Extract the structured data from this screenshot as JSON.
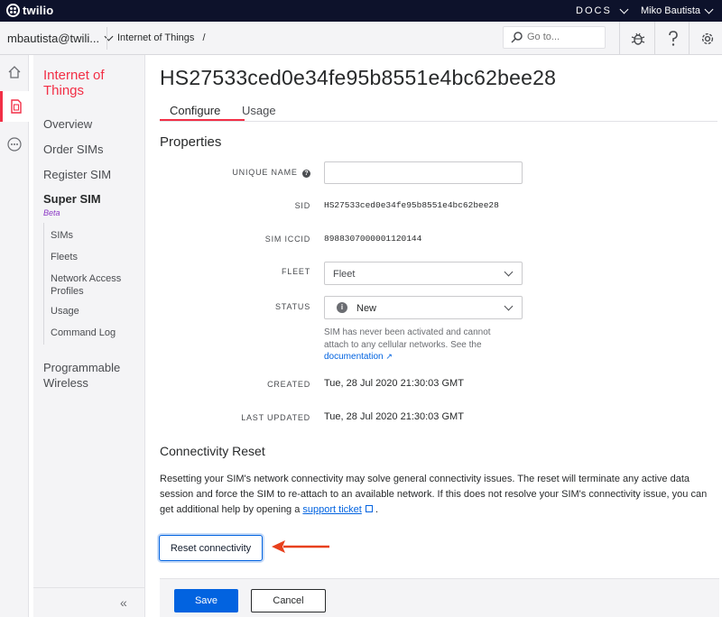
{
  "topbar": {
    "logo_text": "twilio",
    "docs_label": "DOCS",
    "user_name": "Miko Bautista"
  },
  "subbar": {
    "account": "mbautista@twili...",
    "breadcrumb": "Internet of Things",
    "breadcrumb_sep": "/",
    "search_placeholder": "Go to..."
  },
  "icons": {
    "rail": [
      "home-icon",
      "sim-icon",
      "more-icon"
    ],
    "toolbar": [
      "search-icon",
      "bug-icon",
      "help-icon",
      "settings-icon"
    ]
  },
  "sidebar": {
    "title": "Internet of Things",
    "items": [
      {
        "label": "Overview"
      },
      {
        "label": "Order SIMs"
      },
      {
        "label": "Register SIM"
      }
    ],
    "super_sim": {
      "label": "Super SIM",
      "badge": "Beta",
      "sub_items": [
        {
          "label": "SIMs"
        },
        {
          "label": "Fleets"
        },
        {
          "label": "Network Access Profiles"
        },
        {
          "label": "Usage"
        },
        {
          "label": "Command Log"
        }
      ]
    },
    "programmable": "Programmable Wireless",
    "collapse_glyph": "«"
  },
  "main": {
    "title": "HS27533ced0e34fe95b8551e4bc62bee28",
    "tabs": [
      {
        "label": "Configure",
        "active": true
      },
      {
        "label": "Usage",
        "active": false
      }
    ],
    "properties_title": "Properties",
    "fields": {
      "unique_name_label": "UNIQUE NAME",
      "unique_name_help_glyph": "?",
      "unique_name_value": "",
      "sid_label": "SID",
      "sid_value": "HS27533ced0e34fe95b8551e4bc62bee28",
      "iccid_label": "SIM ICCID",
      "iccid_value": "8988307000001120144",
      "fleet_label": "FLEET",
      "fleet_value": "Fleet",
      "status_label": "STATUS",
      "status_value": "New",
      "status_info_glyph": "i",
      "status_help": "SIM has never been activated and cannot attach to any cellular networks. See the",
      "status_help_link": "documentation",
      "status_help_link_glyph": "↗",
      "created_label": "CREATED",
      "created_value": "Tue, 28 Jul 2020 21:30:03 GMT",
      "updated_label": "LAST UPDATED",
      "updated_value": "Tue, 28 Jul 2020 21:30:03 GMT"
    },
    "connectivity": {
      "title": "Connectivity Reset",
      "paragraph": "Resetting your SIM's network connectivity may solve general connectivity issues. The reset will terminate any active data session and force the SIM to re-attach to an available network. If this does not resolve your SIM's connectivity issue, you can get additional help by opening a",
      "link": "support ticket",
      "trailing": ".",
      "button": "Reset connectivity"
    },
    "footer": {
      "save": "Save",
      "cancel": "Cancel"
    }
  },
  "colors": {
    "accent_red": "#f22f46",
    "link_blue": "#0263e0",
    "topbar_bg": "#0d122b",
    "annotation_arrow": "#e8401c"
  }
}
